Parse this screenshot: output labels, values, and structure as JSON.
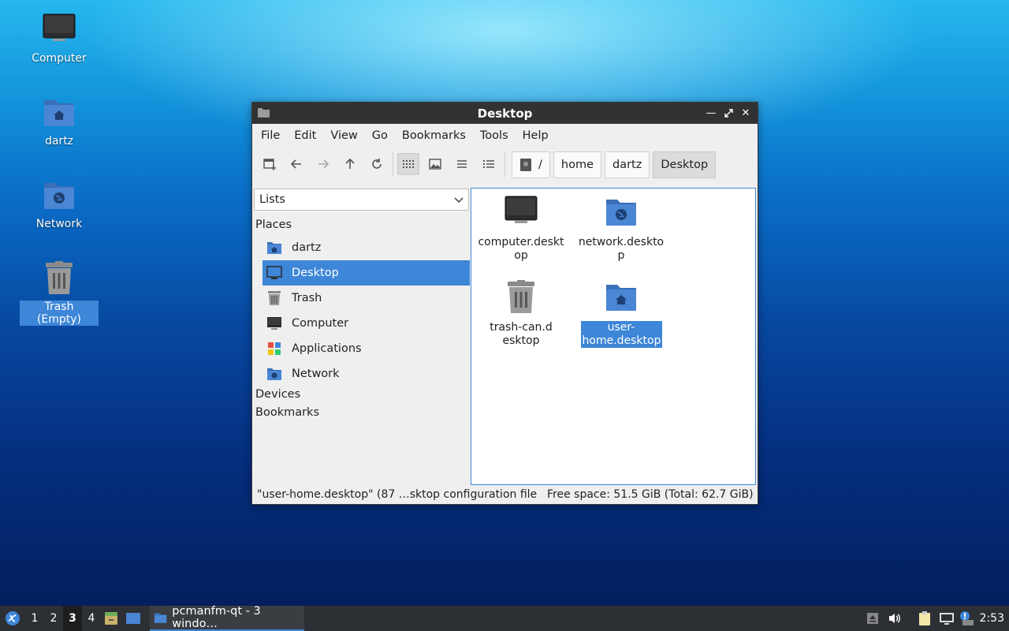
{
  "desktop": {
    "icons": [
      {
        "label": "Computer",
        "icon": "computer-icon"
      },
      {
        "label": "dartz",
        "icon": "home-folder-icon"
      },
      {
        "label": "Network",
        "icon": "network-folder-icon"
      },
      {
        "label": "Trash (Empty)",
        "icon": "trash-icon",
        "selected": true
      }
    ]
  },
  "window": {
    "title": "Desktop",
    "menu": [
      "File",
      "Edit",
      "View",
      "Go",
      "Bookmarks",
      "Tools",
      "Help"
    ],
    "toolbar": {
      "buttons": [
        "new-tab-icon",
        "back-icon",
        "forward-icon",
        "up-icon",
        "reload-icon",
        "icon-view-icon",
        "thumbnail-view-icon",
        "compact-view-icon",
        "detailed-list-view-icon"
      ],
      "active_view": "icon-view-icon"
    },
    "breadcrumb": {
      "root": "/",
      "parts": [
        "home",
        "dartz",
        "Desktop"
      ],
      "current": "Desktop"
    },
    "sidebar": {
      "mode": "Lists",
      "sections": {
        "places": "Places",
        "devices": "Devices",
        "bookmarks": "Bookmarks"
      },
      "places": [
        {
          "label": "dartz",
          "icon": "home-folder-icon"
        },
        {
          "label": "Desktop",
          "icon": "desktop-icon",
          "selected": true
        },
        {
          "label": "Trash",
          "icon": "trash-icon"
        },
        {
          "label": "Computer",
          "icon": "computer-icon"
        },
        {
          "label": "Applications",
          "icon": "applications-icon"
        },
        {
          "label": "Network",
          "icon": "network-folder-icon"
        }
      ]
    },
    "files": [
      {
        "name": "computer.desktop",
        "icon": "computer-icon"
      },
      {
        "name": "network.desktop",
        "icon": "network-folder-icon"
      },
      {
        "name": "trash-can.desktop",
        "icon": "trash-icon"
      },
      {
        "name": "user-home.desktop",
        "icon": "home-folder-icon",
        "selected": true
      }
    ],
    "status": {
      "selection": "\"user-home.desktop\" (87 …sktop configuration file",
      "free_space": "Free space: 51.5 GiB (Total: 62.7 GiB)"
    }
  },
  "taskbar": {
    "workspaces": [
      "1",
      "2",
      "3",
      "4"
    ],
    "current_workspace": "3",
    "task_label": "pcmanfm-qt - 3 windo…",
    "clock": "2:53"
  },
  "colors": {
    "accent": "#3d86d8",
    "titlebar": "#303234",
    "folder": "#4a86d4",
    "taskbar": "#2c2f33"
  }
}
